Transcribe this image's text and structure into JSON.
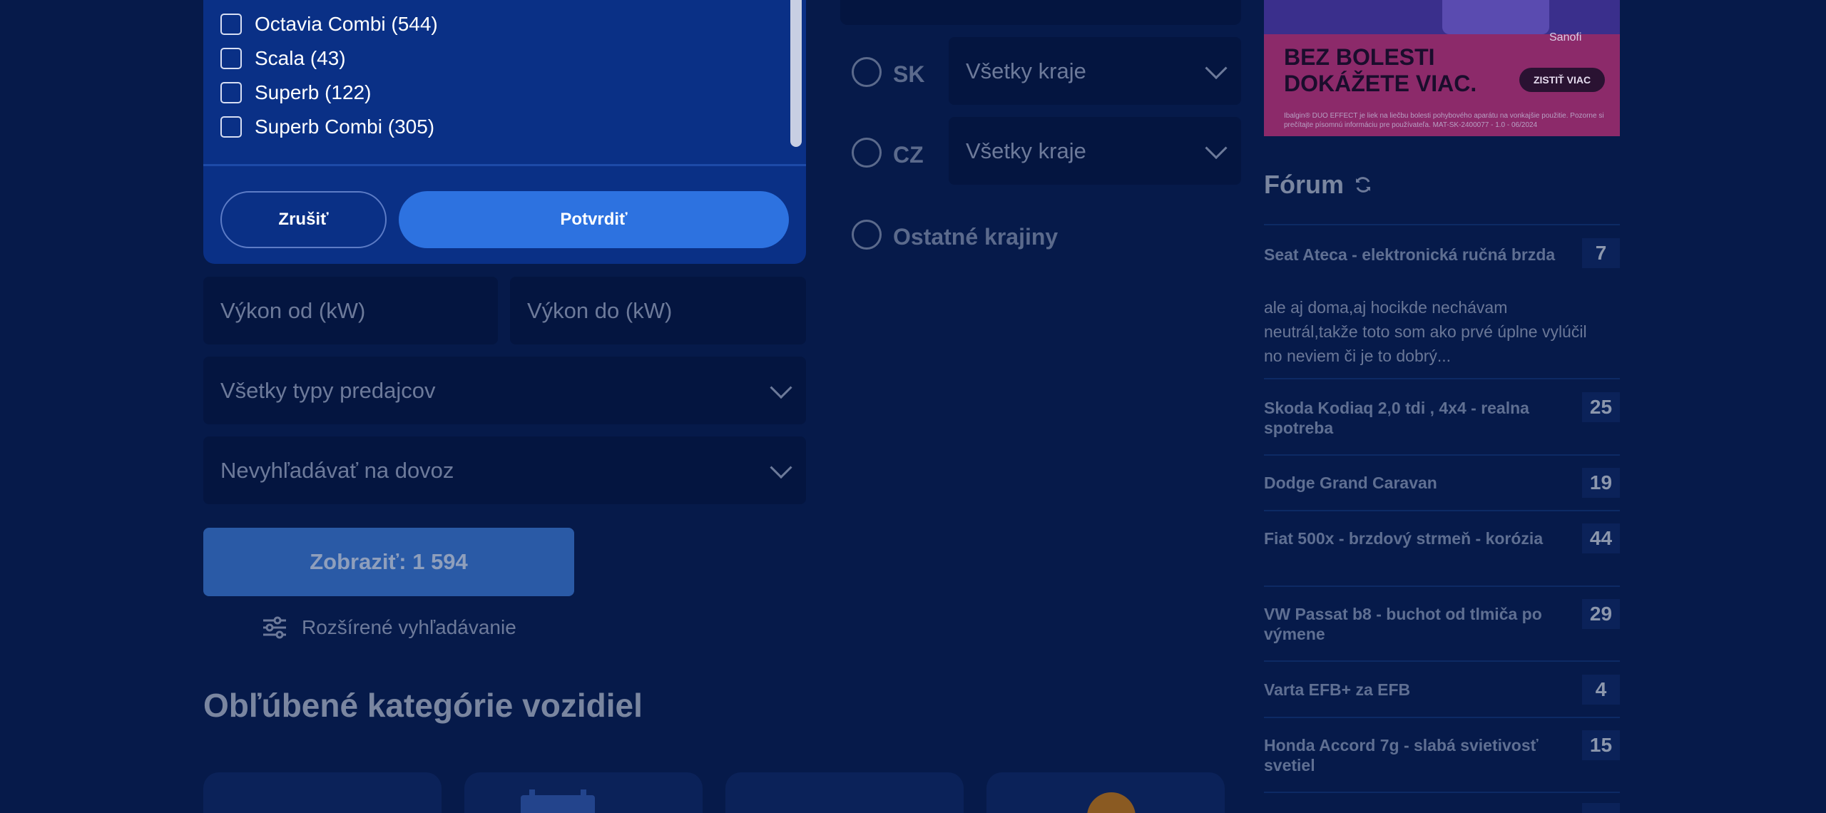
{
  "model_filter": {
    "items": [
      {
        "label": "Octavia Combi (544)"
      },
      {
        "label": "Scala (43)"
      },
      {
        "label": "Superb (122)"
      },
      {
        "label": "Superb Combi (305)"
      }
    ],
    "cancel_label": "Zrušiť",
    "confirm_label": "Potvrdiť"
  },
  "power": {
    "from_placeholder": "Výkon od (kW)",
    "to_placeholder": "Výkon do (kW)"
  },
  "seller_type": {
    "value": "Všetky typy predajcov"
  },
  "import_filter": {
    "value": "Nevyhľadávať na dovoz"
  },
  "show_button": {
    "label": "Zobraziť: 1 594"
  },
  "advanced_search": {
    "label": "Rozšírené vyhľadávanie"
  },
  "popular_categories": {
    "title": "Obľúbené kategórie vozidiel"
  },
  "location": {
    "sk": {
      "label": "SK",
      "region": "Všetky kraje"
    },
    "cz": {
      "label": "CZ",
      "region": "Všetky kraje"
    },
    "other": {
      "label": "Ostatné krajiny"
    }
  },
  "ad": {
    "brand": "Sanofi",
    "headline": "BEZ BOLESTI DOKÁŽETE VIAC.",
    "cta": "ZISTIŤ VIAC",
    "fine_print": "Ibalgin® DUO EFFECT je liek na liečbu bolesti pohybového aparátu na vonkajšie použitie. Pozorne si prečítajte písomnú informáciu pre používateľa. MAT-SK-2400077 - 1.0 - 06/2024",
    "colors": {
      "background": "#8c2a6a",
      "top": "#3a2f8c"
    }
  },
  "forum": {
    "title": "Fórum",
    "icon": "refresh-icon",
    "threads": [
      {
        "title": "Seat Ateca - elektronická ručná brzda",
        "count": "7"
      },
      {
        "title": "Skoda Kodiaq 2,0 tdi , 4x4 - realna spotreba",
        "count": "25"
      },
      {
        "title": "Dodge Grand Caravan",
        "count": "19"
      },
      {
        "title": "Fiat 500x - brzdový strmeň - korózia",
        "count": "44"
      },
      {
        "title": "VW Passat b8 - buchot od tlmiča po výmene",
        "count": "29"
      },
      {
        "title": "Varta EFB+ za EFB",
        "count": "4"
      },
      {
        "title": "Honda Accord 7g - slabá svietivosť svetiel",
        "count": "15"
      }
    ],
    "snippet": "ale aj doma,aj hocikde nechávam neutrál,takže toto som ako prvé úplne vylúčil no neviem či je to dobrý..."
  },
  "colors": {
    "background": "#061a4a",
    "panel": "#0a3086",
    "primary_button": "#2d72e0",
    "field": "#041540"
  }
}
